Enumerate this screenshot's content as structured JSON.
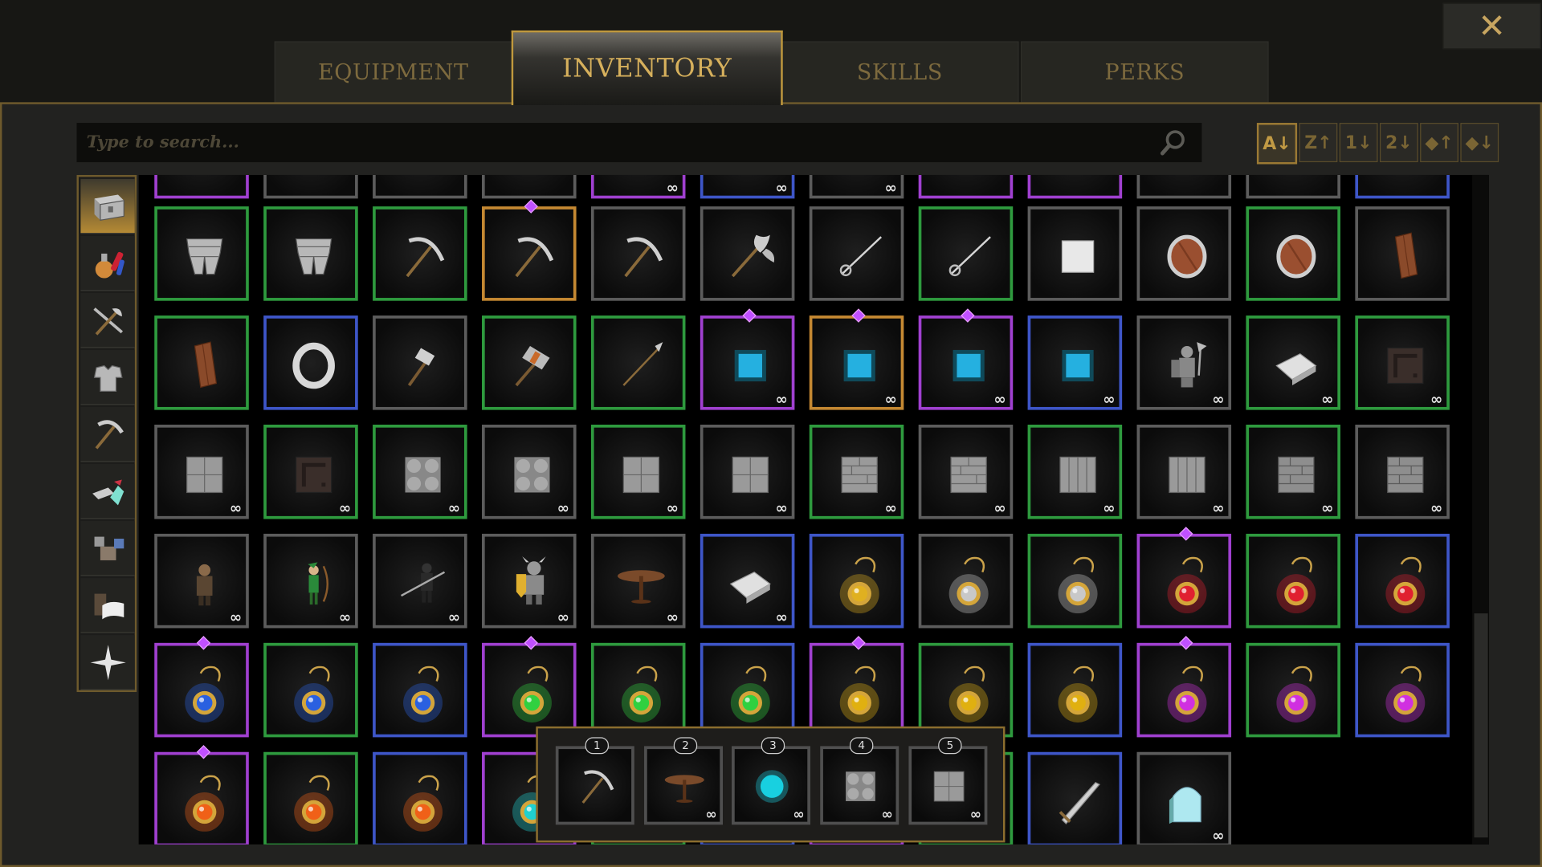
{
  "tabs": [
    {
      "label": "EQUIPMENT",
      "active": false
    },
    {
      "label": "INVENTORY",
      "active": true
    },
    {
      "label": "SKILLS",
      "active": false
    },
    {
      "label": "PERKS",
      "active": false
    }
  ],
  "close": {
    "label": "✕",
    "icon": "close-icon"
  },
  "search": {
    "placeholder": "Type to search...",
    "value": "",
    "icon": "search-icon"
  },
  "sort_buttons": [
    {
      "label": "A↓",
      "icon": "sort-alpha-asc-icon",
      "active": true
    },
    {
      "label": "Z↑",
      "icon": "sort-alpha-desc-icon",
      "active": false
    },
    {
      "label": "1↓",
      "icon": "sort-num-asc-icon",
      "active": false
    },
    {
      "label": "2↓",
      "icon": "sort-num-desc-icon",
      "active": false
    },
    {
      "label": "◆↑",
      "icon": "sort-rarity-asc-icon",
      "active": false
    },
    {
      "label": "◆↓",
      "icon": "sort-rarity-desc-icon",
      "active": false
    }
  ],
  "categories": [
    {
      "icon": "chest-icon",
      "active": true
    },
    {
      "icon": "potion-icon",
      "active": false
    },
    {
      "icon": "weapons-icon",
      "active": false
    },
    {
      "icon": "armor-icon",
      "active": false
    },
    {
      "icon": "pickaxe-icon",
      "active": false
    },
    {
      "icon": "materials-icon",
      "active": false
    },
    {
      "icon": "blocks-icon",
      "active": false
    },
    {
      "icon": "books-icon",
      "active": false
    },
    {
      "icon": "star-icon",
      "active": false
    }
  ],
  "rarity_colors": {
    "common": "#5c5c5c",
    "uncommon": "#2e9a3e",
    "rare": "#3e56c8",
    "epic": "#a040d0",
    "legendary": "#c48832"
  },
  "infinite_symbol": "∞",
  "grid_rows": [
    [
      {
        "item": "unknown",
        "rarity": "epic",
        "infinite": false,
        "gem": false
      },
      {
        "item": "unknown",
        "rarity": "common",
        "infinite": false,
        "gem": false
      },
      {
        "item": "unknown",
        "rarity": "common",
        "infinite": false,
        "gem": false
      },
      {
        "item": "unknown",
        "rarity": "common",
        "infinite": false,
        "gem": false
      },
      {
        "item": "unknown",
        "rarity": "epic",
        "infinite": true,
        "gem": false
      },
      {
        "item": "unknown",
        "rarity": "rare",
        "infinite": true,
        "gem": false
      },
      {
        "item": "unknown",
        "rarity": "common",
        "infinite": true,
        "gem": false
      },
      {
        "item": "unknown",
        "rarity": "epic",
        "infinite": false,
        "gem": false
      },
      {
        "item": "unknown",
        "rarity": "epic",
        "infinite": false,
        "gem": false
      },
      {
        "item": "unknown",
        "rarity": "common",
        "infinite": false,
        "gem": false
      },
      {
        "item": "unknown",
        "rarity": "common",
        "infinite": false,
        "gem": false
      },
      {
        "item": "unknown",
        "rarity": "rare",
        "infinite": false,
        "gem": false
      }
    ],
    [
      {
        "item": "leg-armor",
        "rarity": "uncommon",
        "infinite": false,
        "gem": false
      },
      {
        "item": "leg-armor",
        "rarity": "uncommon",
        "infinite": false,
        "gem": false
      },
      {
        "item": "pickaxe",
        "rarity": "uncommon",
        "infinite": false,
        "gem": false
      },
      {
        "item": "pickaxe",
        "rarity": "legendary",
        "infinite": false,
        "gem": true
      },
      {
        "item": "pickaxe",
        "rarity": "common",
        "infinite": false,
        "gem": false
      },
      {
        "item": "battle-axe",
        "rarity": "common",
        "infinite": false,
        "gem": false
      },
      {
        "item": "rapier",
        "rarity": "common",
        "infinite": false,
        "gem": false
      },
      {
        "item": "rapier",
        "rarity": "uncommon",
        "infinite": false,
        "gem": false
      },
      {
        "item": "white-block",
        "rarity": "common",
        "infinite": false,
        "gem": false
      },
      {
        "item": "round-shield",
        "rarity": "common",
        "infinite": false,
        "gem": false
      },
      {
        "item": "round-shield",
        "rarity": "uncommon",
        "infinite": false,
        "gem": false
      },
      {
        "item": "wood-plank",
        "rarity": "common",
        "infinite": false,
        "gem": false
      }
    ],
    [
      {
        "item": "wood-plank",
        "rarity": "uncommon",
        "infinite": false,
        "gem": false
      },
      {
        "item": "silver-ring",
        "rarity": "rare",
        "infinite": false,
        "gem": false
      },
      {
        "item": "war-hammer",
        "rarity": "common",
        "infinite": false,
        "gem": false
      },
      {
        "item": "maul",
        "rarity": "uncommon",
        "infinite": false,
        "gem": false
      },
      {
        "item": "spear",
        "rarity": "uncommon",
        "infinite": false,
        "gem": false
      },
      {
        "item": "cyan-tile",
        "rarity": "epic",
        "infinite": true,
        "gem": true
      },
      {
        "item": "cyan-tile",
        "rarity": "legendary",
        "infinite": true,
        "gem": true
      },
      {
        "item": "cyan-tile",
        "rarity": "epic",
        "infinite": true,
        "gem": true
      },
      {
        "item": "cyan-tile",
        "rarity": "rare",
        "infinite": true,
        "gem": false
      },
      {
        "item": "knight-statue",
        "rarity": "common",
        "infinite": true,
        "gem": false
      },
      {
        "item": "silver-ingot",
        "rarity": "uncommon",
        "infinite": true,
        "gem": false
      },
      {
        "item": "dark-block",
        "rarity": "uncommon",
        "infinite": true,
        "gem": false
      }
    ],
    [
      {
        "item": "stone-tile-4",
        "rarity": "common",
        "infinite": true,
        "gem": false
      },
      {
        "item": "dark-block",
        "rarity": "uncommon",
        "infinite": true,
        "gem": false
      },
      {
        "item": "round-tile",
        "rarity": "uncommon",
        "infinite": true,
        "gem": false
      },
      {
        "item": "round-tile",
        "rarity": "common",
        "infinite": true,
        "gem": false
      },
      {
        "item": "stone-tile-4",
        "rarity": "uncommon",
        "infinite": true,
        "gem": false
      },
      {
        "item": "stone-tile-4",
        "rarity": "common",
        "infinite": true,
        "gem": false
      },
      {
        "item": "brick-tile",
        "rarity": "uncommon",
        "infinite": true,
        "gem": false
      },
      {
        "item": "brick-tile",
        "rarity": "common",
        "infinite": true,
        "gem": false
      },
      {
        "item": "pillar-tile",
        "rarity": "uncommon",
        "infinite": true,
        "gem": false
      },
      {
        "item": "pillar-tile",
        "rarity": "common",
        "infinite": true,
        "gem": false
      },
      {
        "item": "stone-brick",
        "rarity": "uncommon",
        "infinite": true,
        "gem": false
      },
      {
        "item": "stone-brick",
        "rarity": "common",
        "infinite": true,
        "gem": false
      }
    ],
    [
      {
        "item": "bandit-figure",
        "rarity": "common",
        "infinite": true,
        "gem": false
      },
      {
        "item": "archer-figure",
        "rarity": "common",
        "infinite": true,
        "gem": false
      },
      {
        "item": "spearman-figure",
        "rarity": "common",
        "infinite": true,
        "gem": false
      },
      {
        "item": "armored-knight",
        "rarity": "common",
        "infinite": true,
        "gem": false
      },
      {
        "item": "round-table",
        "rarity": "common",
        "infinite": true,
        "gem": false
      },
      {
        "item": "silver-ingot",
        "rarity": "rare",
        "infinite": true,
        "gem": false
      },
      {
        "item": "gold-amulet",
        "rarity": "rare",
        "infinite": false,
        "gem": false
      },
      {
        "item": "silver-amulet",
        "rarity": "common",
        "infinite": false,
        "gem": false
      },
      {
        "item": "silver-amulet",
        "rarity": "uncommon",
        "infinite": false,
        "gem": false
      },
      {
        "item": "red-amulet",
        "rarity": "epic",
        "infinite": false,
        "gem": true
      },
      {
        "item": "red-amulet",
        "rarity": "uncommon",
        "infinite": false,
        "gem": false
      },
      {
        "item": "red-amulet",
        "rarity": "rare",
        "infinite": false,
        "gem": false
      }
    ],
    [
      {
        "item": "blue-amulet",
        "rarity": "epic",
        "infinite": false,
        "gem": true
      },
      {
        "item": "blue-amulet",
        "rarity": "uncommon",
        "infinite": false,
        "gem": false
      },
      {
        "item": "blue-amulet",
        "rarity": "rare",
        "infinite": false,
        "gem": false
      },
      {
        "item": "green-amulet",
        "rarity": "epic",
        "infinite": false,
        "gem": true
      },
      {
        "item": "green-amulet",
        "rarity": "uncommon",
        "infinite": false,
        "gem": false
      },
      {
        "item": "green-amulet",
        "rarity": "rare",
        "infinite": false,
        "gem": false
      },
      {
        "item": "yellow-amulet",
        "rarity": "epic",
        "infinite": false,
        "gem": true
      },
      {
        "item": "yellow-amulet",
        "rarity": "uncommon",
        "infinite": false,
        "gem": false
      },
      {
        "item": "yellow-amulet",
        "rarity": "rare",
        "infinite": false,
        "gem": false
      },
      {
        "item": "purple-amulet",
        "rarity": "epic",
        "infinite": false,
        "gem": true
      },
      {
        "item": "purple-amulet",
        "rarity": "uncommon",
        "infinite": false,
        "gem": false
      },
      {
        "item": "purple-amulet",
        "rarity": "rare",
        "infinite": false,
        "gem": false
      }
    ],
    [
      {
        "item": "orange-amulet",
        "rarity": "epic",
        "infinite": false,
        "gem": true
      },
      {
        "item": "orange-amulet",
        "rarity": "uncommon",
        "infinite": false,
        "gem": false
      },
      {
        "item": "orange-amulet",
        "rarity": "rare",
        "infinite": false,
        "gem": false
      },
      {
        "item": "cyan-amulet",
        "rarity": "epic",
        "infinite": false,
        "gem": false
      },
      {
        "item": "hidden",
        "rarity": "uncommon",
        "infinite": false,
        "gem": false
      },
      {
        "item": "hidden",
        "rarity": "rare",
        "infinite": false,
        "gem": false
      },
      {
        "item": "hidden",
        "rarity": "epic",
        "infinite": false,
        "gem": false
      },
      {
        "item": "hidden",
        "rarity": "uncommon",
        "infinite": false,
        "gem": false
      },
      {
        "item": "steel-sword",
        "rarity": "rare",
        "infinite": false,
        "gem": false
      },
      {
        "item": "ice-door",
        "rarity": "common",
        "infinite": true,
        "gem": false
      },
      {
        "item": "empty",
        "rarity": "none",
        "infinite": false,
        "gem": false
      },
      {
        "item": "empty",
        "rarity": "none",
        "infinite": false,
        "gem": false
      }
    ]
  ],
  "hotbar": [
    {
      "number": "1",
      "item": "pickaxe",
      "rarity": "legendary",
      "infinite": false
    },
    {
      "number": "2",
      "item": "round-table",
      "rarity": "common",
      "infinite": true
    },
    {
      "number": "3",
      "item": "cyan-orb",
      "rarity": "common",
      "infinite": true
    },
    {
      "number": "4",
      "item": "round-tile",
      "rarity": "common",
      "infinite": true
    },
    {
      "number": "5",
      "item": "stone-tile-4",
      "rarity": "uncommon",
      "infinite": true
    }
  ]
}
